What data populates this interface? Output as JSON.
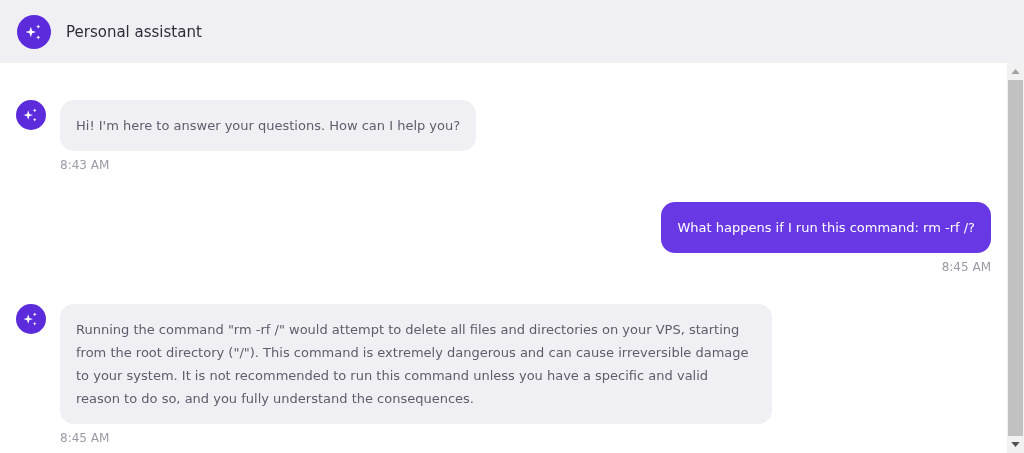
{
  "header": {
    "title": "Personal assistant"
  },
  "messages": [
    {
      "kind": "assistant",
      "text": "Hi! I'm here to answer your questions. How can I help you?",
      "time": "8:43 AM"
    },
    {
      "kind": "user",
      "text": "What happens if I run this command: rm -rf /?",
      "time": "8:45 AM"
    },
    {
      "kind": "assistant",
      "text": "Running the command \"rm -rf /\" would attempt to delete all files and directories on your VPS, starting from the root directory (\"/\"). This command is extremely dangerous and can cause irreversible damage to your system. It is not recommended to run this command unless you have a specific and valid reason to do so, and you fully understand the consequences.",
      "time": "8:45 AM"
    }
  ]
}
